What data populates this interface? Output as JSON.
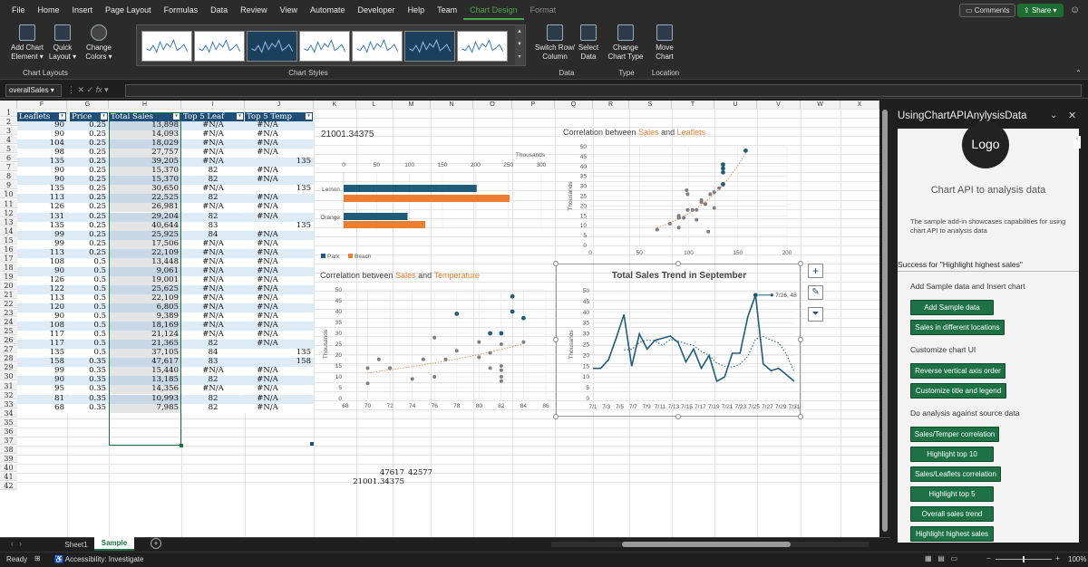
{
  "menu": {
    "tabs": [
      "File",
      "Home",
      "Insert",
      "Page Layout",
      "Formulas",
      "Data",
      "Review",
      "View",
      "Automate",
      "Developer",
      "Help",
      "Team",
      "Chart Design",
      "Format"
    ],
    "active": "Chart Design",
    "comments": "Comments",
    "share": "Share"
  },
  "ribbon": {
    "add_chart": "Add Chart Element",
    "quick_layout": "Quick Layout",
    "change_colors": "Change Colors",
    "group_layouts": "Chart Layouts",
    "group_styles": "Chart Styles",
    "switch_row": "Switch Row/ Column",
    "select_data": "Select Data",
    "group_data": "Data",
    "change_type": "Change Chart Type",
    "group_type": "Type",
    "move_chart": "Move Chart",
    "group_location": "Location"
  },
  "formula": {
    "namebox": "overallSales",
    "fx": "fx"
  },
  "columns": [
    "F",
    "G",
    "H",
    "I",
    "J",
    "K",
    "L",
    "M",
    "N",
    "O",
    "P",
    "Q",
    "R",
    "S",
    "T",
    "U",
    "V",
    "W",
    "X"
  ],
  "table": {
    "headers": [
      "Leaflets",
      "Price",
      "Total Sales",
      "Top 5 Leaf",
      "Top 5 Temp"
    ],
    "rows": [
      [
        "90",
        "0.25",
        "13,898",
        "#N/A",
        "#N/A",
        ""
      ],
      [
        "90",
        "0.25",
        "14,093",
        "#N/A",
        "#N/A",
        ""
      ],
      [
        "104",
        "0.25",
        "18,029",
        "#N/A",
        "#N/A",
        ""
      ],
      [
        "98",
        "0.25",
        "27,757",
        "#N/A",
        "#N/A",
        ""
      ],
      [
        "135",
        "0.25",
        "39,205",
        "#N/A",
        "",
        "135"
      ],
      [
        "90",
        "0.25",
        "15,370",
        "82",
        "#N/A",
        ""
      ],
      [
        "90",
        "0.25",
        "15,370",
        "82",
        "#N/A",
        ""
      ],
      [
        "135",
        "0.25",
        "30,650",
        "#N/A",
        "",
        "135"
      ],
      [
        "113",
        "0.25",
        "22,525",
        "82",
        "#N/A",
        ""
      ],
      [
        "126",
        "0.25",
        "26,981",
        "#N/A",
        "#N/A",
        ""
      ],
      [
        "131",
        "0.25",
        "29,204",
        "82",
        "#N/A",
        ""
      ],
      [
        "135",
        "0.25",
        "40,644",
        "83",
        "",
        "135"
      ],
      [
        "99",
        "0.25",
        "25,925",
        "84",
        "#N/A",
        ""
      ],
      [
        "99",
        "0.25",
        "17,506",
        "#N/A",
        "#N/A",
        ""
      ],
      [
        "113",
        "0.25",
        "22,109",
        "#N/A",
        "#N/A",
        ""
      ],
      [
        "108",
        "0.5",
        "13,448",
        "#N/A",
        "#N/A",
        ""
      ],
      [
        "90",
        "0.5",
        "9,061",
        "#N/A",
        "#N/A",
        ""
      ],
      [
        "126",
        "0.5",
        "19,001",
        "#N/A",
        "#N/A",
        ""
      ],
      [
        "122",
        "0.5",
        "25,625",
        "#N/A",
        "#N/A",
        ""
      ],
      [
        "113",
        "0.5",
        "22,109",
        "#N/A",
        "#N/A",
        ""
      ],
      [
        "120",
        "0.5",
        "6,805",
        "#N/A",
        "#N/A",
        ""
      ],
      [
        "90",
        "0.5",
        "9,389",
        "#N/A",
        "#N/A",
        ""
      ],
      [
        "108",
        "0.5",
        "18,169",
        "#N/A",
        "#N/A",
        ""
      ],
      [
        "117",
        "0.5",
        "21,124",
        "#N/A",
        "#N/A",
        ""
      ],
      [
        "117",
        "0.5",
        "21,365",
        "82",
        "#N/A",
        ""
      ],
      [
        "135",
        "0.5",
        "37,105",
        "84",
        "",
        "135"
      ],
      [
        "158",
        "0.35",
        "47,617",
        "83",
        "",
        "158"
      ],
      [
        "99",
        "0.35",
        "15,440",
        "#N/A",
        "#N/A",
        ""
      ],
      [
        "90",
        "0.35",
        "13,185",
        "82",
        "#N/A",
        ""
      ],
      [
        "95",
        "0.35",
        "14,356",
        "#N/A",
        "#N/A",
        ""
      ],
      [
        "81",
        "0.35",
        "10,993",
        "82",
        "#N/A",
        ""
      ],
      [
        "68",
        "0.35",
        "7,985",
        "82",
        "#N/A",
        ""
      ]
    ]
  },
  "loose_cells": {
    "a": "47617",
    "b": "42577",
    "c": "21001.34375"
  },
  "chart_data": [
    {
      "type": "bar",
      "title": "21001.34375",
      "categories": [
        "Lemon",
        "Orange"
      ],
      "series": [
        {
          "name": "Park",
          "values": [
            202,
            97
          ]
        },
        {
          "name": "Beach",
          "values": [
            252,
            124
          ]
        }
      ],
      "xticks": [
        "0",
        "50",
        "100",
        "150",
        "200",
        "250",
        "300"
      ],
      "xlim": [
        0,
        300
      ],
      "unit_label": "Thousands",
      "colors": [
        "#1f5c7a",
        "#ed7d31"
      ]
    },
    {
      "type": "scatter",
      "title_parts": [
        "Correlation between ",
        "Sales",
        " and ",
        "Leaflets"
      ],
      "ylabel": "Thousands",
      "xticks": [
        "0",
        "50",
        "100",
        "150",
        "200"
      ],
      "yticks": [
        "0",
        "5",
        "10",
        "15",
        "20",
        "25",
        "30",
        "35",
        "40",
        "45",
        "50"
      ],
      "xlim": [
        0,
        200
      ],
      "ylim": [
        0,
        50
      ],
      "points": [
        [
          68,
          8
        ],
        [
          81,
          11
        ],
        [
          90,
          14
        ],
        [
          90,
          14
        ],
        [
          90,
          15
        ],
        [
          90,
          9
        ],
        [
          90,
          15
        ],
        [
          95,
          14
        ],
        [
          98,
          28
        ],
        [
          99,
          26
        ],
        [
          99,
          18
        ],
        [
          104,
          18
        ],
        [
          108,
          13
        ],
        [
          108,
          18
        ],
        [
          113,
          23
        ],
        [
          113,
          22
        ],
        [
          113,
          22
        ],
        [
          117,
          21
        ],
        [
          117,
          21
        ],
        [
          120,
          7
        ],
        [
          122,
          26
        ],
        [
          126,
          27
        ],
        [
          126,
          19
        ],
        [
          131,
          29
        ],
        [
          135,
          39
        ],
        [
          135,
          31
        ],
        [
          135,
          41
        ],
        [
          135,
          37
        ],
        [
          158,
          48
        ]
      ]
    },
    {
      "type": "scatter",
      "title_parts": [
        "Correlation between ",
        "Sales",
        " and ",
        "Temperature"
      ],
      "ylabel": "Thousands",
      "xticks": [
        "68",
        "70",
        "72",
        "74",
        "76",
        "78",
        "80",
        "82",
        "84",
        "86"
      ],
      "yticks": [
        "0",
        "5",
        "10",
        "15",
        "20",
        "25",
        "30",
        "35",
        "40",
        "45",
        "50"
      ],
      "xlim": [
        68,
        86
      ],
      "ylim": [
        0,
        50
      ],
      "points": [
        [
          70,
          7
        ],
        [
          70,
          14
        ],
        [
          71,
          18
        ],
        [
          72,
          14
        ],
        [
          74,
          9
        ],
        [
          75,
          18
        ],
        [
          76,
          28
        ],
        [
          76,
          10
        ],
        [
          77,
          18
        ],
        [
          78,
          39
        ],
        [
          78,
          22
        ],
        [
          80,
          19
        ],
        [
          80,
          26
        ],
        [
          81,
          30
        ],
        [
          81,
          14
        ],
        [
          81,
          21
        ],
        [
          82,
          25
        ],
        [
          82,
          13
        ],
        [
          82,
          30
        ],
        [
          82,
          10
        ],
        [
          82,
          15
        ],
        [
          82,
          8
        ],
        [
          83,
          47
        ],
        [
          83,
          40
        ],
        [
          84,
          37
        ],
        [
          84,
          26
        ]
      ]
    },
    {
      "type": "line",
      "title": "Total Sales Trend in September",
      "ylabel": "Thousands",
      "annotation": "7/26, 48",
      "xticks": [
        "7/1",
        "7/3",
        "7/5",
        "7/7",
        "7/9",
        "7/11",
        "7/13",
        "7/15",
        "7/17",
        "7/19",
        "7/21",
        "7/23",
        "7/25",
        "7/27",
        "7/29",
        "7/31"
      ],
      "yticks": [
        "0",
        "5",
        "10",
        "15",
        "20",
        "25",
        "30",
        "35",
        "40",
        "45",
        "50"
      ],
      "ylim": [
        0,
        50
      ],
      "values": [
        14,
        14,
        18,
        28,
        39,
        15,
        30,
        23,
        27,
        28,
        29,
        26,
        17,
        23,
        14,
        20,
        8,
        10,
        21,
        21,
        38,
        48,
        16,
        13,
        14,
        11,
        8
      ]
    }
  ],
  "pane": {
    "title": "UsingChartAPIAnylysisData",
    "logo": "Logo",
    "heading": "Chart API to analysis data",
    "desc": "The sample add-in showcases capabilities for using chart API to analysis data",
    "status": "Success for \"Highlight highest sales\"",
    "sec1": "Add Sample data and Insert chart",
    "btn_add": "Add Sample data",
    "btn_locations": "Sales in different locations",
    "sec2": "Customize chart UI",
    "btn_reverse": "Reverse vertical axis order",
    "btn_title": "Customize title and legend",
    "sec3": "Do analysis against source data",
    "btn_temp": "Sales/Temper correlation",
    "btn_top10": "Highlight top 10",
    "btn_leaflets": "Sales/Leaflets correlation",
    "btn_top5": "Highlight top 5",
    "btn_overall": "Overall sales trend",
    "btn_highest": "Highlight highest sales"
  },
  "sheets": {
    "tabs": [
      "Sheet1",
      "Sample"
    ],
    "active": "Sample"
  },
  "status": {
    "ready": "Ready",
    "accessibility": "Accessibility: Investigate",
    "zoom": "100%"
  }
}
